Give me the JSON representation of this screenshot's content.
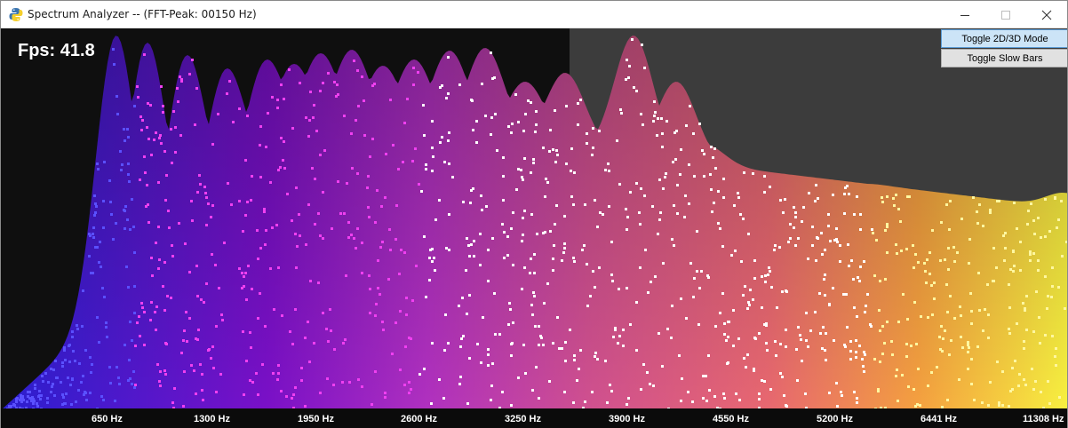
{
  "window": {
    "title": "Spectrum Analyzer -- (FFT-Peak: 00150 Hz)",
    "app_icon": "python-icon",
    "controls": {
      "minimize": "minimize-icon",
      "maximize": "maximize-icon",
      "close": "close-icon"
    }
  },
  "overlay": {
    "fps_label": "Fps: 41.8"
  },
  "buttons": {
    "toggle_mode": "Toggle 2D/3D Mode",
    "toggle_slow": "Toggle Slow Bars"
  },
  "axis": {
    "labels": [
      "650 Hz",
      "1300 Hz",
      "1950 Hz",
      "2600 Hz",
      "3250 Hz",
      "3900 Hz",
      "4550 Hz",
      "5200 Hz",
      "6441 Hz",
      "11308 Hz"
    ]
  },
  "colors": {
    "background": "#3c3c3c",
    "spectrum_low": "#2a1fd0",
    "spectrum_mid": "#c040c8",
    "spectrum_high": "#f0e040",
    "peak_dots": "#ffffff"
  }
}
